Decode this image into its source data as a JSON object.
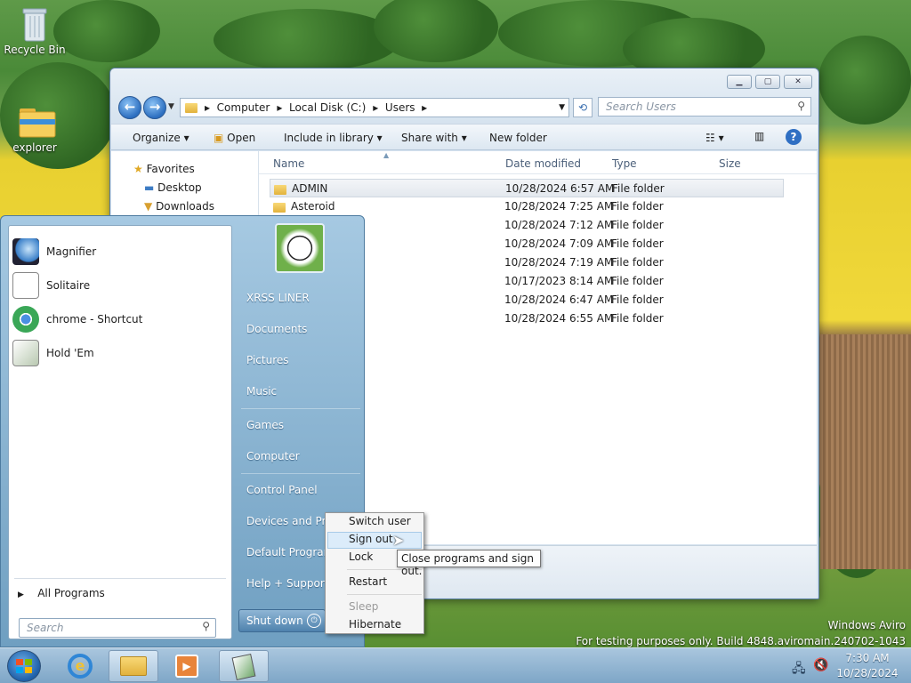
{
  "desktop": {
    "icons": [
      {
        "label": "Recycle Bin",
        "icon": "recycle-bin-icon"
      },
      {
        "label": "explorer",
        "icon": "folder-icon"
      }
    ],
    "watermark": [
      "Windows Aviro",
      "For testing purposes only. Build 4848.aviromain.240702-1043"
    ]
  },
  "explorer": {
    "caption_buttons": [
      "minimize",
      "maximize",
      "close"
    ],
    "breadcrumb": [
      "Computer",
      "Local Disk (C:)",
      "Users"
    ],
    "search_placeholder": "Search Users",
    "commands": [
      "Organize",
      "Open",
      "Include in library",
      "Share with",
      "New folder"
    ],
    "nav": {
      "favorites": "Favorites",
      "items": [
        "Desktop",
        "Downloads"
      ]
    },
    "columns": [
      "Name",
      "Date modified",
      "Type",
      "Size"
    ],
    "files": [
      {
        "name": "ADMIN",
        "date": "10/28/2024 6:57 AM",
        "type": "File folder"
      },
      {
        "name": "Asteroid",
        "date": "10/28/2024 7:25 AM",
        "type": "File folder"
      },
      {
        "name": "",
        "date": "10/28/2024 7:12 AM",
        "type": "File folder"
      },
      {
        "name": "",
        "date": "10/28/2024 7:09 AM",
        "type": "File folder"
      },
      {
        "name": "",
        "date": "10/28/2024 7:19 AM",
        "type": "File folder"
      },
      {
        "name": "",
        "date": "10/17/2023 8:14 AM",
        "type": "File folder"
      },
      {
        "name": "",
        "date": "10/28/2024 6:47 AM",
        "type": "File folder"
      },
      {
        "name": "",
        "date": "10/28/2024 6:55 AM",
        "type": "File folder"
      }
    ]
  },
  "start_menu": {
    "programs": [
      "Magnifier",
      "Solitaire",
      "chrome - Shortcut",
      "Hold 'Em"
    ],
    "all_programs": "All Programs",
    "search_placeholder": "Search",
    "user": "XRSS LINER",
    "links": [
      "Documents",
      "Pictures",
      "Music",
      "Games",
      "Computer",
      "Control Panel",
      "Devices and Printers",
      "Default Programs",
      "Help + Support"
    ],
    "shutdown": "Shut down"
  },
  "power_menu": {
    "items": [
      "Switch user",
      "Sign out",
      "Lock",
      "Restart",
      "Sleep",
      "Hibernate"
    ],
    "tooltip": "Close programs and sign out."
  },
  "taskbar": {
    "time": "7:30 AM",
    "date": "10/28/2024"
  }
}
